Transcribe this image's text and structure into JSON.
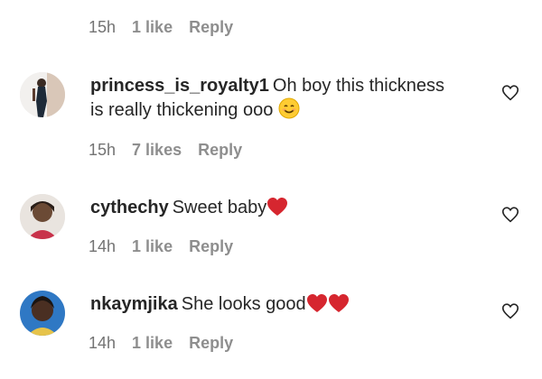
{
  "top_meta": {
    "time": "15h",
    "likes": "1 like",
    "reply": "Reply"
  },
  "comments": [
    {
      "username": "princess_is_royalty1",
      "text_before": "Oh boy this thickness is really thickening ooo",
      "emojis": [
        "smiling-face"
      ],
      "time": "15h",
      "likes": "7 likes",
      "reply": "Reply"
    },
    {
      "username": "cythechy",
      "text_before": "Sweet baby",
      "emojis": [
        "red-heart"
      ],
      "time": "14h",
      "likes": "1 like",
      "reply": "Reply"
    },
    {
      "username": "nkaymjika",
      "text_before": "She looks good",
      "emojis": [
        "red-heart",
        "red-heart"
      ],
      "time": "14h",
      "likes": "1 like",
      "reply": "Reply"
    }
  ],
  "colors": {
    "text": "#262626",
    "meta": "#8e8e8e",
    "heart": "#e0245e"
  }
}
